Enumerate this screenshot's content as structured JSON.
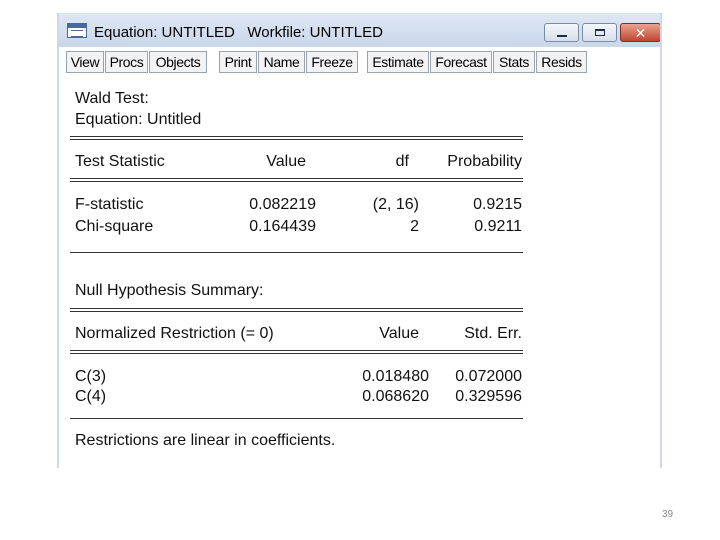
{
  "window": {
    "title": "Equation: UNTITLED   Workfile: UNTITLED",
    "controls": {
      "minimize": "minimize",
      "maximize": "maximize",
      "close": "close"
    }
  },
  "toolbar": {
    "buttons": [
      "View",
      "Procs",
      "Objects",
      "Print",
      "Name",
      "Freeze",
      "Estimate",
      "Forecast",
      "Stats",
      "Resids"
    ]
  },
  "output": {
    "heading": "Wald Test:",
    "equation": "Equation: Untitled",
    "test_table": {
      "headers": [
        "Test Statistic",
        "Value",
        "df",
        "Probability"
      ],
      "rows": [
        [
          "F-statistic",
          "0.082219",
          "(2, 16)",
          "0.9215"
        ],
        [
          "Chi-square",
          "0.164439",
          "2",
          "0.9211"
        ]
      ]
    },
    "null_summary_label": "Null Hypothesis Summary:",
    "restriction_table": {
      "headers": [
        "Normalized Restriction (= 0)",
        "Value",
        "Std. Err."
      ],
      "rows": [
        [
          "C(3)",
          "0.018480",
          "0.072000"
        ],
        [
          "C(4)",
          "0.068620",
          "0.329596"
        ]
      ]
    },
    "footer_note": "Restrictions are linear in coefficients."
  },
  "page_number": "39"
}
